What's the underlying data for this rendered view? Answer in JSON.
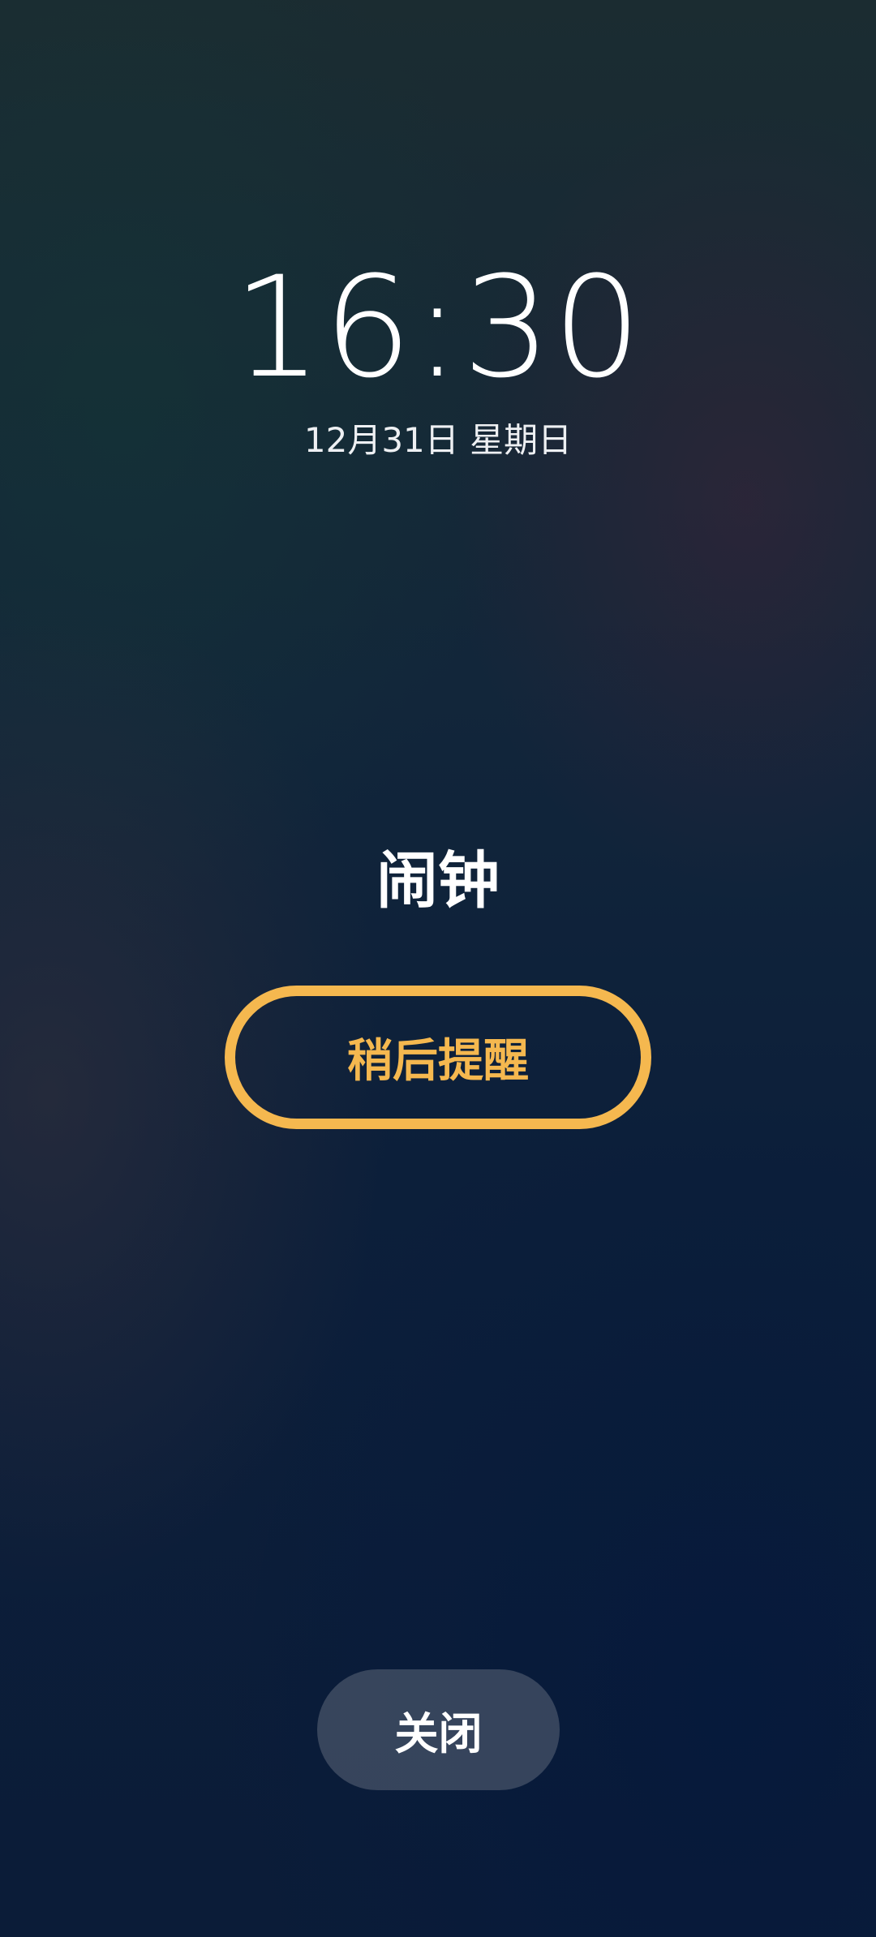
{
  "lockscreen": {
    "time": "16:30",
    "date": "12月31日 星期日"
  },
  "alarm": {
    "title": "闹钟",
    "snooze_label": "稍后提醒",
    "dismiss_label": "关闭"
  },
  "colors": {
    "accent": "#f5b84f",
    "text": "#ffffff",
    "dismiss_bg": "#4a5666"
  }
}
